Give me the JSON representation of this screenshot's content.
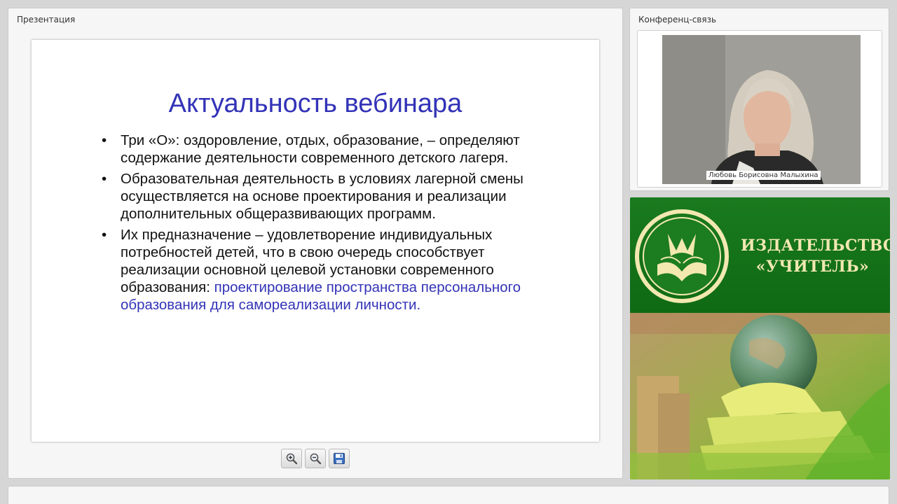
{
  "presentation": {
    "panel_title": "Презентация",
    "slide": {
      "title": "Актуальность вебинара",
      "bullets": [
        {
          "text": "Три «О»: оздоровление, отдых, образование, – определяют содержание деятельности современного детского лагеря."
        },
        {
          "text": "Образовательная деятельность в условиях лагерной смены осуществляется на основе проектирования и реализации дополнительных общеразвивающих программ."
        },
        {
          "text": "Их предназначение – удовлетворение индивидуальных потребностей детей, что в свою очередь способствует реализации  основной целевой установки современного образования:",
          "highlight": "проектирование пространства персонального образования для самореализации личности."
        }
      ],
      "title_color": "#3333b8",
      "highlight_color": "#3333b8"
    },
    "toolbar": {
      "zoom_in_icon": "zoom-in-icon",
      "zoom_out_icon": "zoom-out-icon",
      "save_icon": "save-icon"
    }
  },
  "conference": {
    "panel_title": "Конференц-связь",
    "participant_name": "Любовь Борисовна Малыхина"
  },
  "publisher": {
    "name_line1": "ИЗДАТЕЛЬСТВО",
    "name_line2": "«УЧИТЕЛЬ»",
    "logo_icon": "publisher-logo-icon",
    "brand_green": "#12701a",
    "brand_gold": "#f2e8b0"
  }
}
